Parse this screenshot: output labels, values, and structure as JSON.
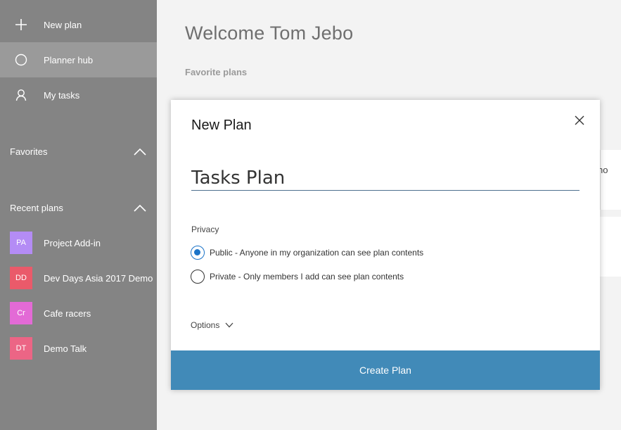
{
  "sidebar": {
    "nav": [
      {
        "label": "New plan",
        "icon": "plus-icon"
      },
      {
        "label": "Planner hub",
        "icon": "circle-icon"
      },
      {
        "label": "My tasks",
        "icon": "person-icon"
      }
    ],
    "favorites_label": "Favorites",
    "recent_label": "Recent plans",
    "recent": [
      {
        "initials": "PA",
        "label": "Project Add-in",
        "color": "#b48cf5"
      },
      {
        "initials": "DD",
        "label": "Dev Days Asia 2017 Demo",
        "color": "#ea5a6a"
      },
      {
        "initials": "Cr",
        "label": "Cafe racers",
        "color": "#e36ad6"
      },
      {
        "initials": "DT",
        "label": "Demo Talk",
        "color": "#ec6585"
      }
    ]
  },
  "main": {
    "welcome": "Welcome Tom Jebo",
    "favorite_plans": "Favorite plans",
    "card_fragment": "no"
  },
  "dialog": {
    "title": "New Plan",
    "plan_name": "Tasks Plan",
    "privacy_label": "Privacy",
    "public_option": "Public - Anyone in my organization can see plan contents",
    "private_option": "Private - Only members I add can see plan contents",
    "selected_privacy": "public",
    "options_label": "Options",
    "create_button": "Create Plan"
  },
  "colors": {
    "sidebar": "#848484",
    "sidebar_active": "#9a9a9a",
    "accent": "#418ab8",
    "radio": "#1a73c8"
  }
}
